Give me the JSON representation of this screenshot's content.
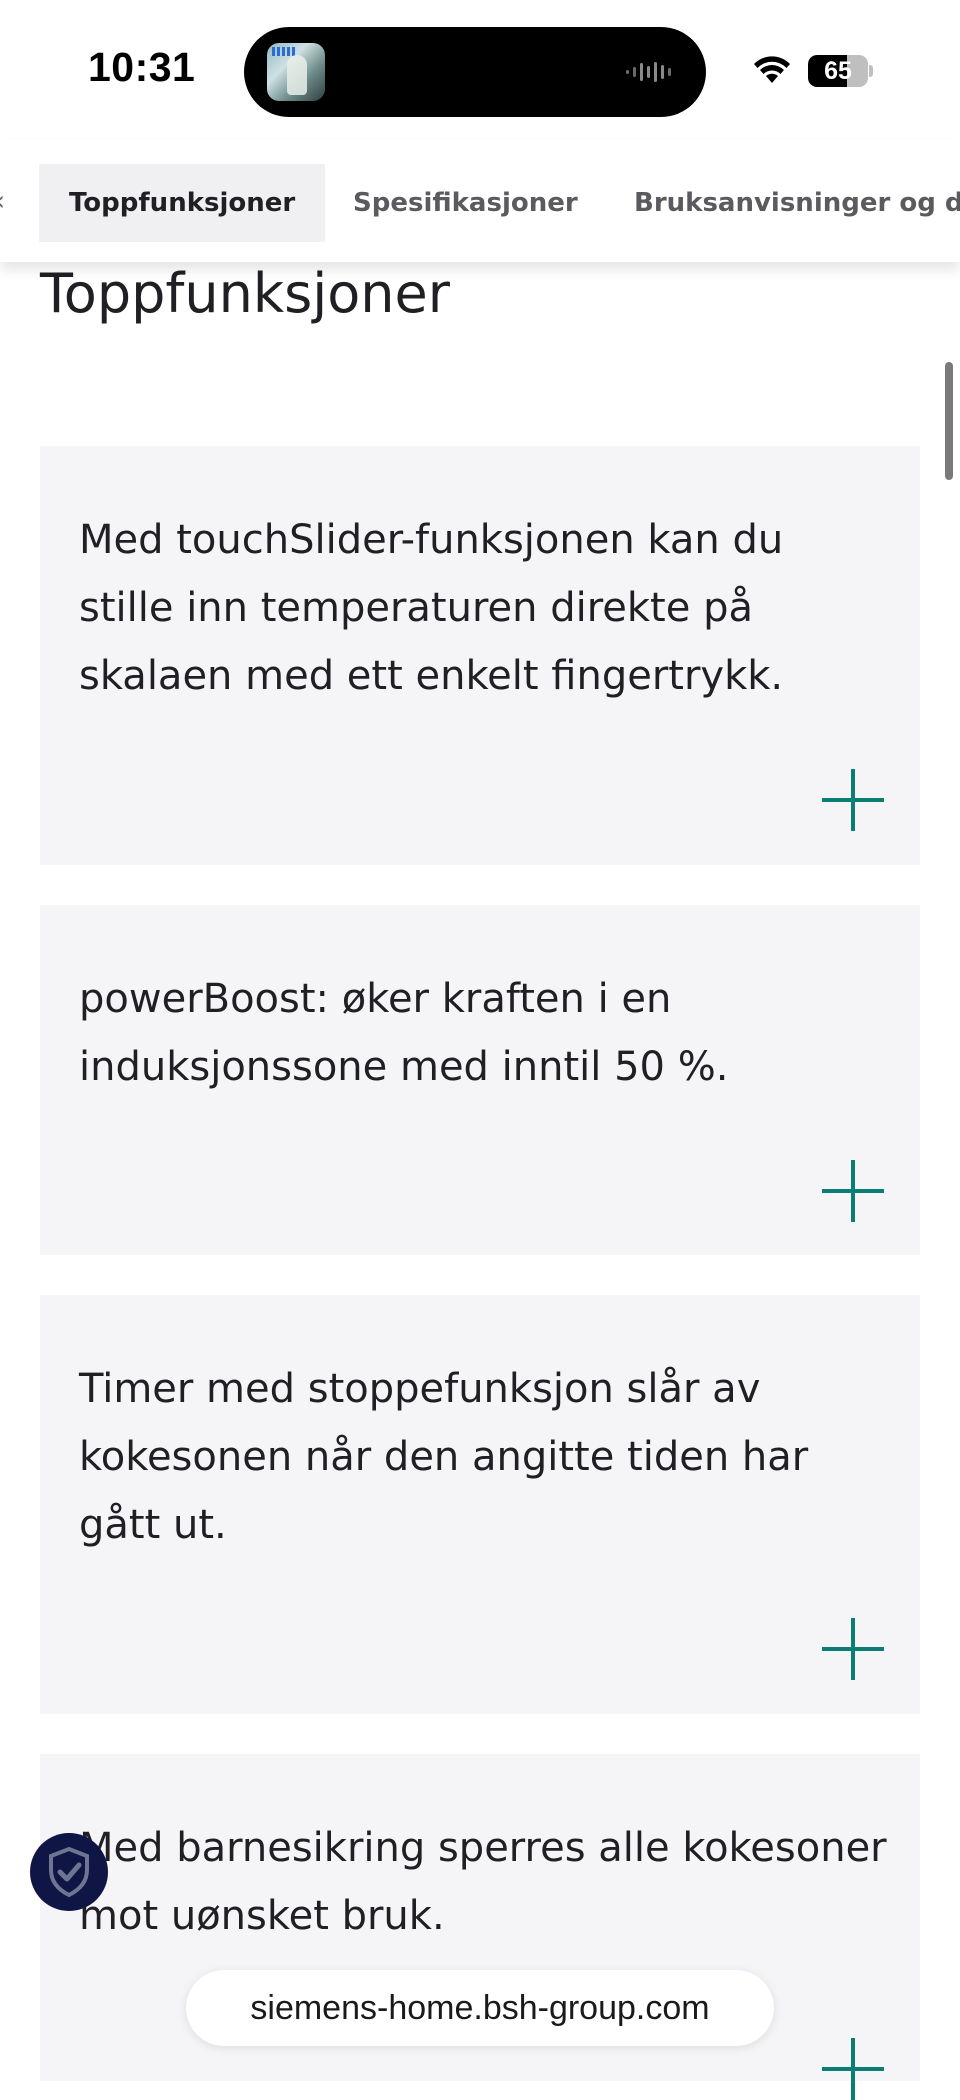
{
  "status_bar": {
    "time": "10:31",
    "battery_percent": "65",
    "battery_level": 0.65,
    "now_playing_icon": "album-art",
    "wave_icon": "audio-waveform-icon",
    "wifi_icon": "wifi-icon"
  },
  "tabs": [
    {
      "label": "Toppfunksjoner",
      "active": true
    },
    {
      "label": "Spesifikasjoner",
      "active": false
    },
    {
      "label": "Bruksanvisninger og dokumenter",
      "active": false
    }
  ],
  "section_title": "Toppfunksjoner",
  "features": [
    {
      "text": "Med touchSlider-funksjonen kan du stille inn temperaturen direkte på skalaen med ett enkelt fingertrykk.",
      "action_icon": "plus-icon"
    },
    {
      "text": "powerBoost: øker kraften i en induksjonssone med inntil 50 %.",
      "action_icon": "plus-icon"
    },
    {
      "text": "Timer med stoppefunksjon slår av kokesonen når den angitte tiden har gått ut.",
      "action_icon": "plus-icon"
    },
    {
      "text": "Med barnesikring sperres alle kokesoner mot uønsket bruk.",
      "action_icon": "plus-icon"
    }
  ],
  "browser": {
    "url": "siemens-home.bsh-group.com"
  },
  "colors": {
    "accent": "#0a7e72",
    "card_bg": "#f5f5f8",
    "badge_bg": "#0f1646"
  },
  "floating_badge_icon": "shield-check-icon"
}
